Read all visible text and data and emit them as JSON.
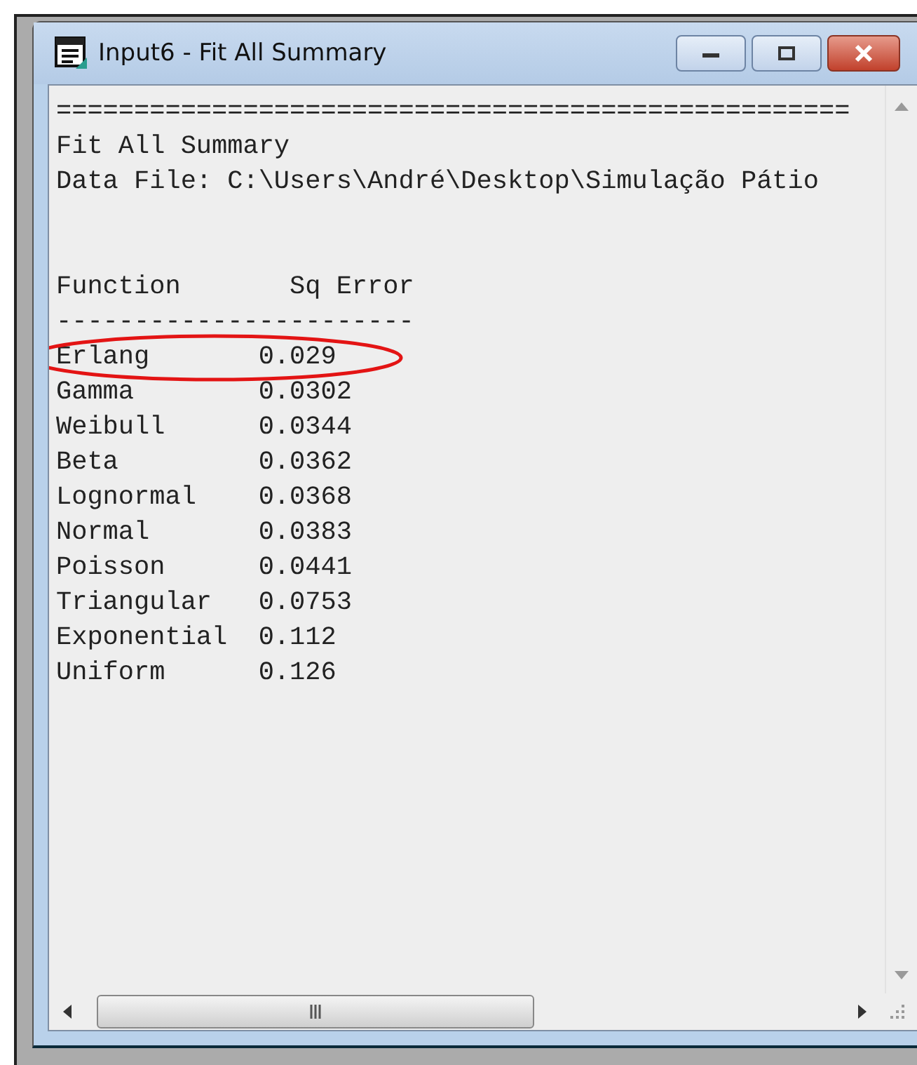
{
  "window": {
    "title": "Input6 - Fit All Summary"
  },
  "output": {
    "separator": "===================================================",
    "heading": "Fit All Summary",
    "data_file": "Data File: C:\\Users\\André\\Desktop\\Simulação Pátio",
    "columns": [
      "Function",
      "Sq Error"
    ],
    "rule": "-----------------------",
    "rows": [
      {
        "function": "Erlang",
        "sq_error": "0.029",
        "circled": true
      },
      {
        "function": "Gamma",
        "sq_error": "0.0302",
        "circled": false
      },
      {
        "function": "Weibull",
        "sq_error": "0.0344",
        "circled": false
      },
      {
        "function": "Beta",
        "sq_error": "0.0362",
        "circled": false
      },
      {
        "function": "Lognormal",
        "sq_error": "0.0368",
        "circled": false
      },
      {
        "function": "Normal",
        "sq_error": "0.0383",
        "circled": false
      },
      {
        "function": "Poisson",
        "sq_error": "0.0441",
        "circled": false
      },
      {
        "function": "Triangular",
        "sq_error": "0.0753",
        "circled": false
      },
      {
        "function": "Exponential",
        "sq_error": "0.112",
        "circled": false
      },
      {
        "function": "Uniform",
        "sq_error": "0.126",
        "circled": false
      }
    ]
  }
}
